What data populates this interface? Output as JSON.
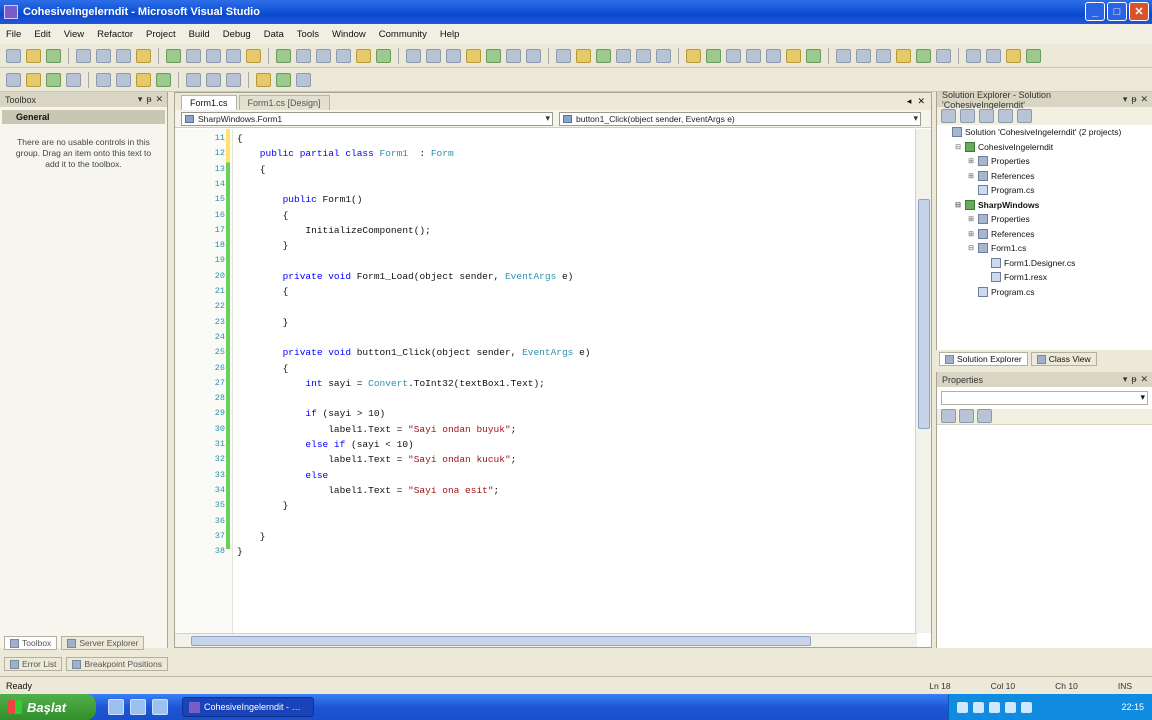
{
  "window": {
    "title": "CohesiveIngelerndit - Microsoft Visual Studio"
  },
  "menu": [
    "File",
    "Edit",
    "View",
    "Refactor",
    "Project",
    "Build",
    "Debug",
    "Data",
    "Tools",
    "Window",
    "Community",
    "Help"
  ],
  "toolbox": {
    "title": "Toolbox",
    "group": "General",
    "note": "There are no usable controls in this group. Drag an item onto this text to add it to the toolbox."
  },
  "left_tabs": [
    "Toolbox",
    "Server Explorer"
  ],
  "left_tabs2": [
    "Error List",
    "Breakpoint Positions"
  ],
  "editor": {
    "tabs": [
      "Form1.cs",
      "Form1.cs [Design]"
    ],
    "nav_left": "SharpWindows.Form1",
    "nav_right": "button1_Click(object sender, EventArgs e)"
  },
  "code": [
    {
      "ln": "11",
      "text": "{"
    },
    {
      "ln": "12",
      "parts": [
        [
          "kw",
          "    public partial class "
        ],
        [
          "ty",
          "Form1"
        ],
        [
          "",
          "  : "
        ],
        [
          "ty",
          "Form"
        ]
      ]
    },
    {
      "ln": "13",
      "text": "    {"
    },
    {
      "ln": "14",
      "text": ""
    },
    {
      "ln": "15",
      "parts": [
        [
          "kw",
          "        public "
        ],
        [
          "",
          "Form1()"
        ]
      ]
    },
    {
      "ln": "16",
      "text": "        {"
    },
    {
      "ln": "17",
      "text": "            InitializeComponent();"
    },
    {
      "ln": "18",
      "text": "        }"
    },
    {
      "ln": "19",
      "text": ""
    },
    {
      "ln": "20",
      "parts": [
        [
          "kw",
          "        private void "
        ],
        [
          "",
          "Form1_Load(object sender, "
        ],
        [
          "ty",
          "EventArgs"
        ],
        [
          "",
          " e)"
        ]
      ]
    },
    {
      "ln": "21",
      "text": "        {"
    },
    {
      "ln": "22",
      "text": ""
    },
    {
      "ln": "23",
      "text": "        }"
    },
    {
      "ln": "24",
      "text": ""
    },
    {
      "ln": "25",
      "parts": [
        [
          "kw",
          "        private void "
        ],
        [
          "",
          "button1_Click(object sender, "
        ],
        [
          "ty",
          "EventArgs"
        ],
        [
          "",
          " e)"
        ]
      ]
    },
    {
      "ln": "26",
      "text": "        {"
    },
    {
      "ln": "27",
      "parts": [
        [
          "kw",
          "            int "
        ],
        [
          "",
          "sayi = "
        ],
        [
          "ty",
          "Convert"
        ],
        [
          "",
          ".ToInt32(textBox1.Text);"
        ]
      ]
    },
    {
      "ln": "28",
      "text": ""
    },
    {
      "ln": "29",
      "parts": [
        [
          "kw",
          "            if "
        ],
        [
          "",
          "(sayi > 10)"
        ]
      ]
    },
    {
      "ln": "30",
      "parts": [
        [
          "",
          "                label1.Text = "
        ],
        [
          "str",
          "\"Sayi ondan buyuk\""
        ],
        [
          "",
          ";"
        ]
      ]
    },
    {
      "ln": "31",
      "parts": [
        [
          "kw",
          "            else if "
        ],
        [
          "",
          "(sayi < 10)"
        ]
      ]
    },
    {
      "ln": "32",
      "parts": [
        [
          "",
          "                label1.Text = "
        ],
        [
          "str",
          "\"Sayi ondan kucuk\""
        ],
        [
          "",
          ";"
        ]
      ]
    },
    {
      "ln": "33",
      "parts": [
        [
          "kw",
          "            else"
        ]
      ]
    },
    {
      "ln": "34",
      "parts": [
        [
          "",
          "                label1.Text = "
        ],
        [
          "str",
          "\"Sayi ona esit\""
        ],
        [
          "",
          ";"
        ]
      ]
    },
    {
      "ln": "35",
      "text": "        }"
    },
    {
      "ln": "36",
      "text": ""
    },
    {
      "ln": "37",
      "text": "    }"
    },
    {
      "ln": "38",
      "text": "}"
    }
  ],
  "solution": {
    "title": "Solution Explorer - Solution 'CohesiveIngelerndit'",
    "items": [
      {
        "label": "Solution 'CohesiveIngelerndit' (2 projects)",
        "depth": 0,
        "icon": "solution"
      },
      {
        "label": "CohesiveIngelerndit",
        "depth": 1,
        "icon": "project"
      },
      {
        "label": "Properties",
        "depth": 2,
        "icon": "folder"
      },
      {
        "label": "References",
        "depth": 2,
        "icon": "folder"
      },
      {
        "label": "Program.cs",
        "depth": 2,
        "icon": "cs"
      },
      {
        "label": "SharpWindows",
        "depth": 1,
        "icon": "project",
        "bold": true
      },
      {
        "label": "Properties",
        "depth": 2,
        "icon": "folder"
      },
      {
        "label": "References",
        "depth": 2,
        "icon": "folder"
      },
      {
        "label": "Form1.cs",
        "depth": 2,
        "icon": "form"
      },
      {
        "label": "Form1.Designer.cs",
        "depth": 3,
        "icon": "cs"
      },
      {
        "label": "Form1.resx",
        "depth": 3,
        "icon": "cs"
      },
      {
        "label": "Program.cs",
        "depth": 2,
        "icon": "cs"
      }
    ]
  },
  "right_tabs": [
    "Solution Explorer",
    "Class View"
  ],
  "properties": {
    "title": "Properties"
  },
  "status": {
    "text": "Ready",
    "ln": "Ln 18",
    "col": "Col 10",
    "ch": "Ch 10",
    "mode": "INS"
  },
  "taskbar": {
    "start": "Başlat",
    "item": "CohesiveIngelerndit - Microsoft Visual Studio",
    "clock": "22:15"
  }
}
